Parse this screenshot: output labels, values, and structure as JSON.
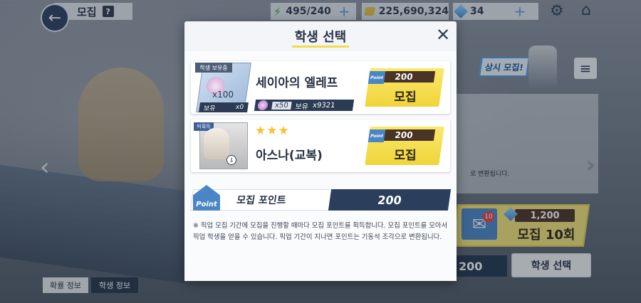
{
  "topbar": {
    "title": "모집",
    "help": "?",
    "ap": "495/240",
    "credits": "225,690,324",
    "gems": "34"
  },
  "background": {
    "banner": "상시 모집!",
    "note": "로 변환됩니다.",
    "recruit10_cost": "1,200",
    "recruit10_badge": "10",
    "recruit10_label": "모집 10회",
    "point_value": "200",
    "select_button": "학생 선택",
    "tab_rate": "확률 정보",
    "tab_student": "학생 정보"
  },
  "modal": {
    "title": "학생 선택",
    "cards": [
      {
        "tag": "학생 보유중",
        "name": "세이아의 엘레프",
        "count_label": "x100",
        "own_label": "보유",
        "own_count": "x0",
        "need_count": "x50",
        "need_own_label": "보유",
        "need_own_count": "x9321",
        "cost": "200",
        "button": "모집"
      },
      {
        "tag": "미획득",
        "stars": "★★★",
        "name": "아스나(교복)",
        "cost": "200",
        "button": "모집"
      }
    ],
    "point_icon": "Point",
    "point_label": "모집 포인트",
    "point_value": "200",
    "notice": "※ 픽업 모집 기간에 모집을 진행할 때마다 모집 포인트를 획득합니다. 모집 포인트를 모아서 픽업 학생을 얻을 수 있습니다. 픽업 기간이 지나면 포인트는 기동석 조각으로 변환됩니다."
  },
  "colors": {
    "accent_yellow": "#f0d43a",
    "navy": "#2b3f5c"
  }
}
